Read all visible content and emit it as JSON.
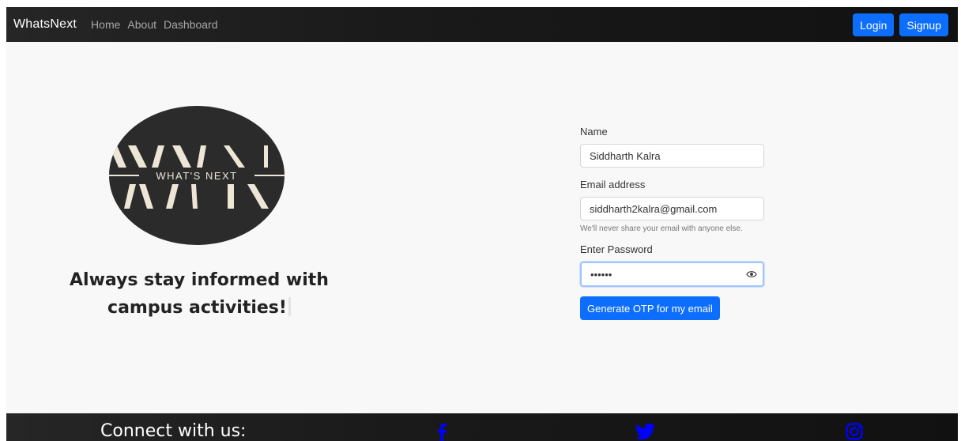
{
  "navbar": {
    "brand": "WhatsNext",
    "links": [
      "Home",
      "About",
      "Dashboard"
    ],
    "login_label": "Login",
    "signup_label": "Signup"
  },
  "hero": {
    "logo_text": "WHAT'S NEXT",
    "tagline_line1": "Always stay informed with",
    "tagline_line2": "campus activities!"
  },
  "form": {
    "name_label": "Name",
    "name_value": "Siddharth Kalra",
    "email_label": "Email address",
    "email_value": "siddharth2kalra@gmail.com",
    "email_help": "We'll never share your email with anyone else.",
    "password_label": "Enter Password",
    "password_value": "••••••",
    "otp_button": "Generate OTP for my email"
  },
  "footer": {
    "connect_text": "Connect with us:",
    "socials": [
      "facebook-icon",
      "twitter-icon",
      "instagram-icon"
    ],
    "social_color": "#0000ff"
  },
  "colors": {
    "primary": "#0d6efd",
    "navbar_bg": "#1c1c1c",
    "page_bg": "#f8f8f8",
    "logo_bg": "#2b2b2b",
    "logo_fg": "#ede6d6"
  }
}
